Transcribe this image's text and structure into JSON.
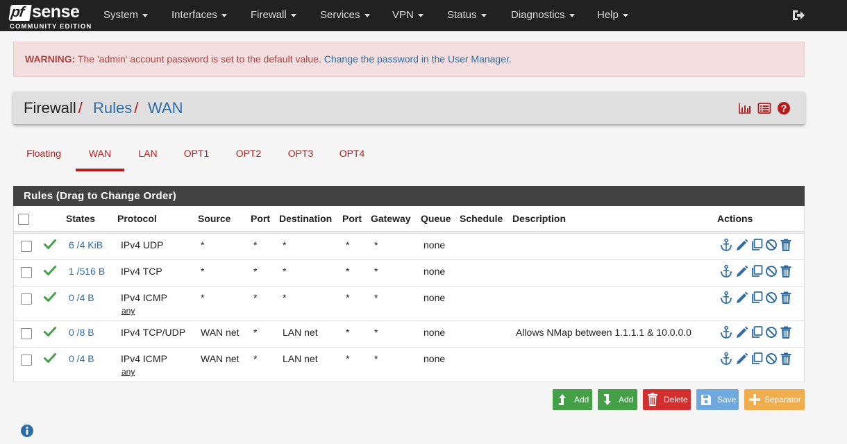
{
  "brand": {
    "name": "pf",
    "name_suffix": "sense",
    "edition": "COMMUNITY EDITION"
  },
  "nav": {
    "items": [
      "System",
      "Interfaces",
      "Firewall",
      "Services",
      "VPN",
      "Status",
      "Diagnostics",
      "Help"
    ],
    "logout_icon": "sign-out-icon"
  },
  "alert": {
    "label": "WARNING:",
    "message": "The 'admin' account password is set to the default value.",
    "link": "Change the password in the User Manager."
  },
  "breadcrumb": {
    "items": [
      "Firewall",
      "Rules",
      "WAN"
    ],
    "separator": "/",
    "icons": [
      "bar-chart-icon",
      "list-icon",
      "help-icon"
    ]
  },
  "tabs": {
    "items": [
      "Floating",
      "WAN",
      "LAN",
      "OPT1",
      "OPT2",
      "OPT3",
      "OPT4"
    ],
    "active": "WAN"
  },
  "rules": {
    "title": "Rules (Drag to Change Order)",
    "columns": [
      "States",
      "Protocol",
      "Source",
      "Port",
      "Destination",
      "Port",
      "Gateway",
      "Queue",
      "Schedule",
      "Description",
      "Actions"
    ],
    "rows": [
      {
        "states": "6 /4 KiB",
        "protocol": "IPv4 UDP",
        "protocol_sub": "",
        "source": "*",
        "sport": "*",
        "destination": "*",
        "dport": "*",
        "gateway": "*",
        "queue": "none",
        "schedule": "",
        "description": ""
      },
      {
        "states": "1 /516 B",
        "protocol": "IPv4 TCP",
        "protocol_sub": "",
        "source": "*",
        "sport": "*",
        "destination": "*",
        "dport": "*",
        "gateway": "*",
        "queue": "none",
        "schedule": "",
        "description": ""
      },
      {
        "states": "0 /4 B",
        "protocol": "IPv4 ICMP",
        "protocol_sub": "any",
        "source": "*",
        "sport": "*",
        "destination": "*",
        "dport": "*",
        "gateway": "*",
        "queue": "none",
        "schedule": "",
        "description": ""
      },
      {
        "states": "0 /8 B",
        "protocol": "IPv4 TCP/UDP",
        "protocol_sub": "",
        "source": "WAN net",
        "sport": "*",
        "destination": "LAN net",
        "dport": "*",
        "gateway": "*",
        "queue": "none",
        "schedule": "",
        "description": "Allows NMap between 1.1.1.1 & 10.0.0.0"
      },
      {
        "states": "0 /4 B",
        "protocol": "IPv4 ICMP",
        "protocol_sub": "any",
        "source": "WAN net",
        "sport": "*",
        "destination": "LAN net",
        "dport": "*",
        "gateway": "*",
        "queue": "none",
        "schedule": "",
        "description": ""
      }
    ],
    "action_icons": [
      "anchor-icon",
      "pencil-icon",
      "copy-icon",
      "ban-icon",
      "trash-icon"
    ]
  },
  "buttons": {
    "add_top": "Add",
    "add_bottom": "Add",
    "delete": "Delete",
    "save": "Save",
    "separator": "Separator"
  },
  "colors": {
    "navbar": "#212121",
    "accent_red": "#b71c1c",
    "link_blue": "#2e6da4",
    "success_green": "#43a047",
    "danger_red": "#d32f2f",
    "save_blue": "#6ea8dc",
    "warning_orange": "#f0ad4e"
  }
}
